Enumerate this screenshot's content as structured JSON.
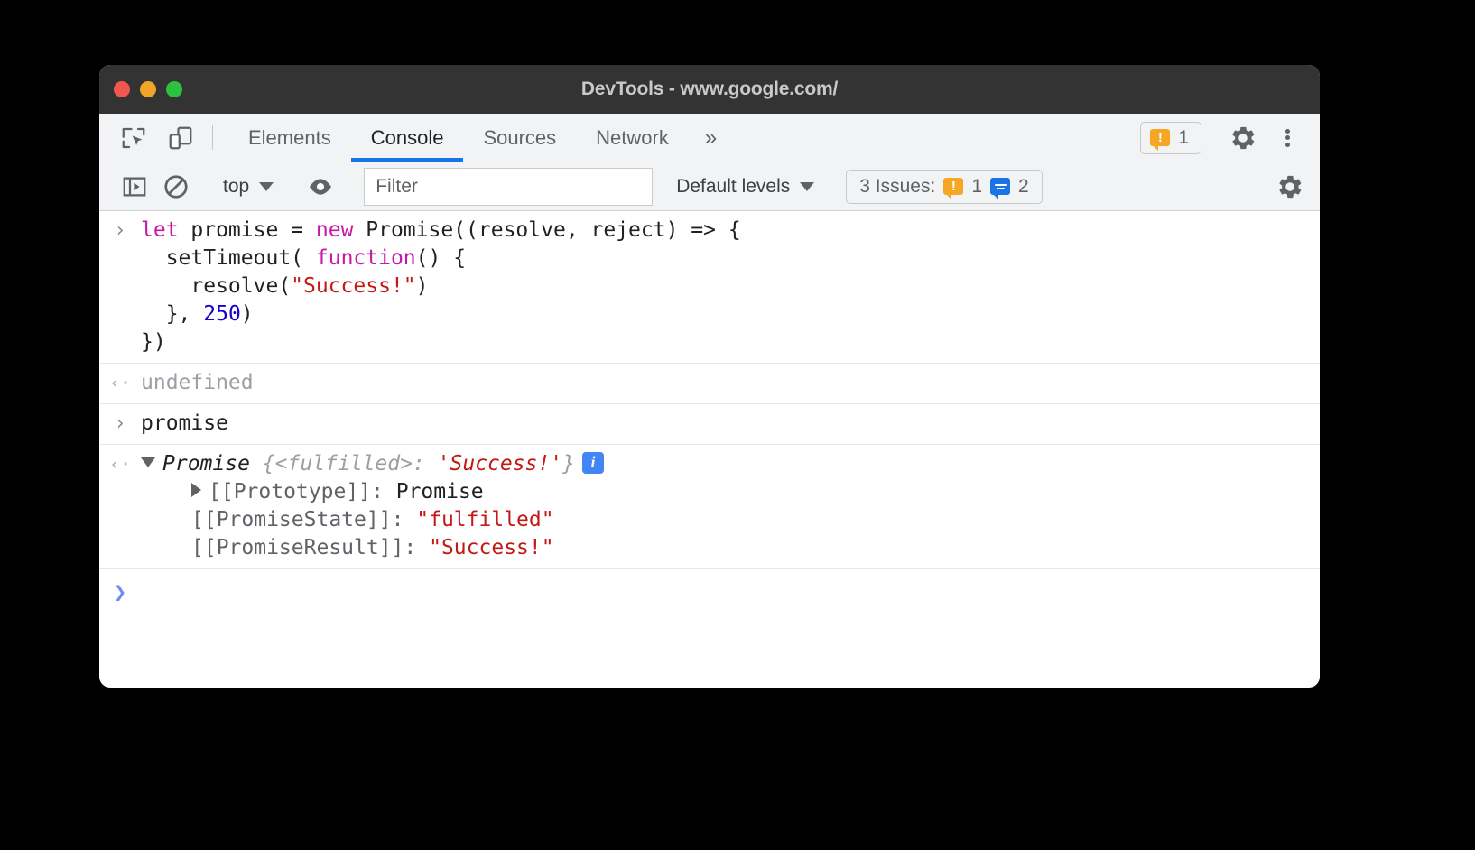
{
  "window": {
    "title": "DevTools - www.google.com/",
    "traffic_lights": [
      "close-red",
      "minimize-yellow",
      "maximize-green"
    ]
  },
  "tabstrip": {
    "icons": [
      "inspect-element-icon",
      "device-toolbar-icon"
    ],
    "tabs": [
      {
        "label": "Elements",
        "active": false
      },
      {
        "label": "Console",
        "active": true
      },
      {
        "label": "Sources",
        "active": false
      },
      {
        "label": "Network",
        "active": false
      }
    ],
    "more_tabs_label": "»",
    "warning_count": "1",
    "settings_icon": "gear-icon",
    "menu_icon": "kebab-menu-icon"
  },
  "console_toolbar": {
    "sidebar_toggle_icon": "console-sidebar-icon",
    "clear_icon": "clear-console-icon",
    "context_label": "top",
    "live_expression_icon": "eye-icon",
    "filter_placeholder": "Filter",
    "filter_value": "",
    "levels_label": "Default levels",
    "issues_label": "3 Issues:",
    "issues_warning_count": "1",
    "issues_info_count": "2",
    "settings_icon": "gear-icon"
  },
  "console": {
    "messages": [
      {
        "kind": "input",
        "gutter": "›",
        "lines": [
          [
            {
              "t": "let ",
              "c": "kw"
            },
            {
              "t": "promise = ",
              "c": ""
            },
            {
              "t": "new ",
              "c": "kw"
            },
            {
              "t": "Promise((resolve, reject) => {",
              "c": ""
            }
          ],
          [
            {
              "t": "  setTimeout( ",
              "c": ""
            },
            {
              "t": "function",
              "c": "kw"
            },
            {
              "t": "() {",
              "c": ""
            }
          ],
          [
            {
              "t": "    resolve(",
              "c": ""
            },
            {
              "t": "\"Success!\"",
              "c": "str"
            },
            {
              "t": ")",
              "c": ""
            }
          ],
          [
            {
              "t": "  }, ",
              "c": ""
            },
            {
              "t": "250",
              "c": "num"
            },
            {
              "t": ")",
              "c": ""
            }
          ],
          [
            {
              "t": "})",
              "c": ""
            }
          ]
        ]
      },
      {
        "kind": "output-undefined",
        "gutter": "‹·",
        "text": "undefined"
      },
      {
        "kind": "input",
        "gutter": "›",
        "lines": [
          [
            {
              "t": "promise",
              "c": ""
            }
          ]
        ]
      }
    ],
    "promise_result": {
      "gutter": "‹·",
      "disclosure": "expanded",
      "class_name": "Promise",
      "brace_open": " {",
      "state_key": "<fulfilled>",
      "colon": ": ",
      "value": "'Success!'",
      "brace_close": "}",
      "info_badge": "i",
      "properties": [
        {
          "disclosure": "collapsed",
          "key": "[[Prototype]]",
          "sep": ": ",
          "value": "Promise",
          "value_color": "plain"
        },
        {
          "disclosure": "none",
          "key": "[[PromiseState]]",
          "sep": ": ",
          "value": "\"fulfilled\"",
          "value_color": "red"
        },
        {
          "disclosure": "none",
          "key": "[[PromiseResult]]",
          "sep": ": ",
          "value": "\"Success!\"",
          "value_color": "red"
        }
      ]
    },
    "prompt": {
      "caret": "❯",
      "value": "",
      "placeholder": ""
    }
  },
  "colors": {
    "accent_blue": "#1a73e8",
    "warning_orange": "#f5a623",
    "info_blue": "#1a73e8",
    "string_red": "#c41a16",
    "keyword_magenta": "#c518a8",
    "number_blue": "#1c00cf",
    "titlebar_bg": "#333333",
    "toolbar_bg": "#f1f3f4"
  }
}
